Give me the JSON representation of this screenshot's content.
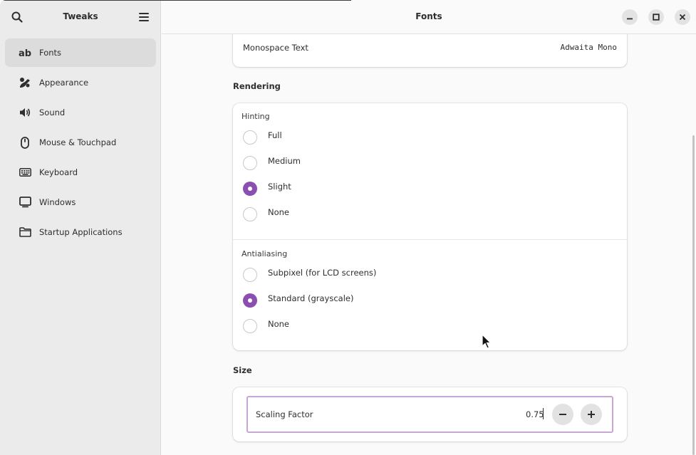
{
  "sidebar": {
    "title": "Tweaks",
    "search_icon": "search-icon",
    "menu_icon": "hamburger-menu-icon",
    "items": [
      {
        "label": "Fonts",
        "icon": "font-ab-icon",
        "active": true
      },
      {
        "label": "Appearance",
        "icon": "appearance-icon",
        "active": false
      },
      {
        "label": "Sound",
        "icon": "speaker-icon",
        "active": false
      },
      {
        "label": "Mouse & Touchpad",
        "icon": "mouse-icon",
        "active": false
      },
      {
        "label": "Keyboard",
        "icon": "keyboard-icon",
        "active": false
      },
      {
        "label": "Windows",
        "icon": "monitor-icon",
        "active": false
      },
      {
        "label": "Startup Applications",
        "icon": "folder-icon",
        "active": false
      }
    ]
  },
  "header": {
    "title": "Fonts",
    "buttons": [
      "minimize-icon",
      "maximize-icon",
      "close-icon"
    ]
  },
  "monospace": {
    "label": "Monospace Text",
    "value": "Adwaita Mono"
  },
  "rendering": {
    "title": "Rendering",
    "hinting": {
      "label": "Hinting",
      "options": [
        "Full",
        "Medium",
        "Slight",
        "None"
      ],
      "selected": "Slight"
    },
    "antialiasing": {
      "label": "Antialiasing",
      "options": [
        "Subpixel (for LCD screens)",
        "Standard (grayscale)",
        "None"
      ],
      "selected": "Standard (grayscale)"
    }
  },
  "size": {
    "title": "Size",
    "scaling_label": "Scaling Factor",
    "scaling_value": "0.75",
    "minus_icon": "minus-icon",
    "plus_icon": "plus-icon"
  },
  "colors": {
    "accent": "#8a4fb0",
    "focus_ring": "#c9a6d6",
    "sidebar_bg": "#ebebeb",
    "active_item_bg": "#dcdcdc"
  }
}
